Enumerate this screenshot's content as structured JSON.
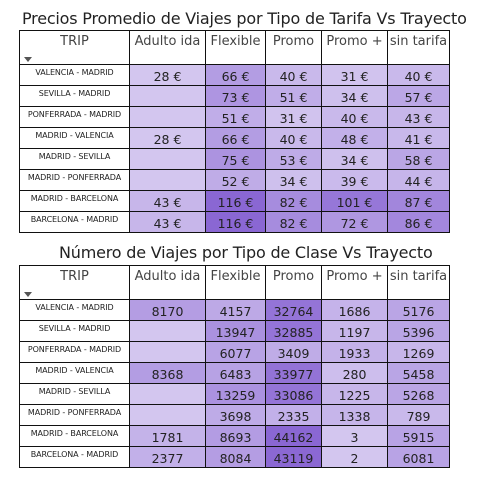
{
  "tables": [
    {
      "id": "tarifa",
      "title": "Precios Promedio de Viajes por Tipo de Tarifa Vs Trayecto",
      "row_header": "TRIP",
      "columns": [
        "Adulto ida",
        "Flexible",
        "Promo",
        "Promo +",
        "sin tarifa"
      ],
      "rows": [
        {
          "trip": "VALENCIA - MADRID",
          "cells": [
            "28 €",
            "66 €",
            "40 €",
            "31 €",
            "40 €"
          ]
        },
        {
          "trip": "SEVILLA - MADRID",
          "cells": [
            "",
            "73 €",
            "51 €",
            "34 €",
            "57 €"
          ]
        },
        {
          "trip": "PONFERRADA - MADRID",
          "cells": [
            "",
            "51 €",
            "31 €",
            "40 €",
            "43 €"
          ]
        },
        {
          "trip": "MADRID - VALENCIA",
          "cells": [
            "28 €",
            "66 €",
            "40 €",
            "48 €",
            "41 €"
          ]
        },
        {
          "trip": "MADRID - SEVILLA",
          "cells": [
            "",
            "75 €",
            "53 €",
            "34 €",
            "58 €"
          ]
        },
        {
          "trip": "MADRID - PONFERRADA",
          "cells": [
            "",
            "52 €",
            "34 €",
            "39 €",
            "44 €"
          ]
        },
        {
          "trip": "MADRID - BARCELONA",
          "cells": [
            "43 €",
            "116 €",
            "82 €",
            "101 €",
            "87 €"
          ]
        },
        {
          "trip": "BARCELONA - MADRID",
          "cells": [
            "43 €",
            "116 €",
            "82 €",
            "72 €",
            "86 €"
          ]
        }
      ]
    },
    {
      "id": "clase",
      "title": "Número de Viajes por Tipo de Clase Vs Trayecto",
      "row_header": "TRIP",
      "columns": [
        "Adulto ida",
        "Flexible",
        "Promo",
        "Promo +",
        "sin tarifa"
      ],
      "rows": [
        {
          "trip": "VALENCIA - MADRID",
          "cells": [
            "8170",
            "4157",
            "32764",
            "1686",
            "5176"
          ]
        },
        {
          "trip": "SEVILLA - MADRID",
          "cells": [
            "",
            "13947",
            "32885",
            "1197",
            "5396"
          ]
        },
        {
          "trip": "PONFERRADA - MADRID",
          "cells": [
            "",
            "6077",
            "3409",
            "1933",
            "1269"
          ]
        },
        {
          "trip": "MADRID - VALENCIA",
          "cells": [
            "8368",
            "6483",
            "33977",
            "280",
            "5458"
          ]
        },
        {
          "trip": "MADRID - SEVILLA",
          "cells": [
            "",
            "13259",
            "33086",
            "1225",
            "5268"
          ]
        },
        {
          "trip": "MADRID - PONFERRADA",
          "cells": [
            "",
            "3698",
            "2335",
            "1338",
            "789"
          ]
        },
        {
          "trip": "MADRID - BARCELONA",
          "cells": [
            "1781",
            "8693",
            "44162",
            "3",
            "5915"
          ]
        },
        {
          "trip": "BARCELONA - MADRID",
          "cells": [
            "2377",
            "8084",
            "43119",
            "2",
            "6081"
          ]
        }
      ]
    }
  ],
  "colors": {
    "scale_low": "#d3c6ef",
    "scale_high": "#8a67d3",
    "text": "#222222",
    "border": "#111111"
  },
  "chart_data": [
    {
      "type": "heatmap",
      "title": "Precios Promedio de Viajes por Tipo de Tarifa Vs Trayecto",
      "x": [
        "Adulto ida",
        "Flexible",
        "Promo",
        "Promo +",
        "sin tarifa"
      ],
      "y": [
        "VALENCIA - MADRID",
        "SEVILLA - MADRID",
        "PONFERRADA - MADRID",
        "MADRID - VALENCIA",
        "MADRID - SEVILLA",
        "MADRID - PONFERRADA",
        "MADRID - BARCELONA",
        "BARCELONA - MADRID"
      ],
      "unit": "€",
      "values": [
        [
          28,
          66,
          40,
          31,
          40
        ],
        [
          null,
          73,
          51,
          34,
          57
        ],
        [
          null,
          51,
          31,
          40,
          43
        ],
        [
          28,
          66,
          40,
          48,
          41
        ],
        [
          null,
          75,
          53,
          34,
          58
        ],
        [
          null,
          52,
          34,
          39,
          44
        ],
        [
          43,
          116,
          82,
          101,
          87
        ],
        [
          43,
          116,
          82,
          72,
          86
        ]
      ]
    },
    {
      "type": "heatmap",
      "title": "Número de Viajes por Tipo de Clase Vs Trayecto",
      "x": [
        "Adulto ida",
        "Flexible",
        "Promo",
        "Promo +",
        "sin tarifa"
      ],
      "y": [
        "VALENCIA - MADRID",
        "SEVILLA - MADRID",
        "PONFERRADA - MADRID",
        "MADRID - VALENCIA",
        "MADRID - SEVILLA",
        "MADRID - PONFERRADA",
        "MADRID - BARCELONA",
        "BARCELONA - MADRID"
      ],
      "values": [
        [
          8170,
          4157,
          32764,
          1686,
          5176
        ],
        [
          null,
          13947,
          32885,
          1197,
          5396
        ],
        [
          null,
          6077,
          3409,
          1933,
          1269
        ],
        [
          8368,
          6483,
          33977,
          280,
          5458
        ],
        [
          null,
          13259,
          33086,
          1225,
          5268
        ],
        [
          null,
          3698,
          2335,
          1338,
          789
        ],
        [
          1781,
          8693,
          44162,
          3,
          5915
        ],
        [
          2377,
          8084,
          43119,
          2,
          6081
        ]
      ]
    }
  ]
}
